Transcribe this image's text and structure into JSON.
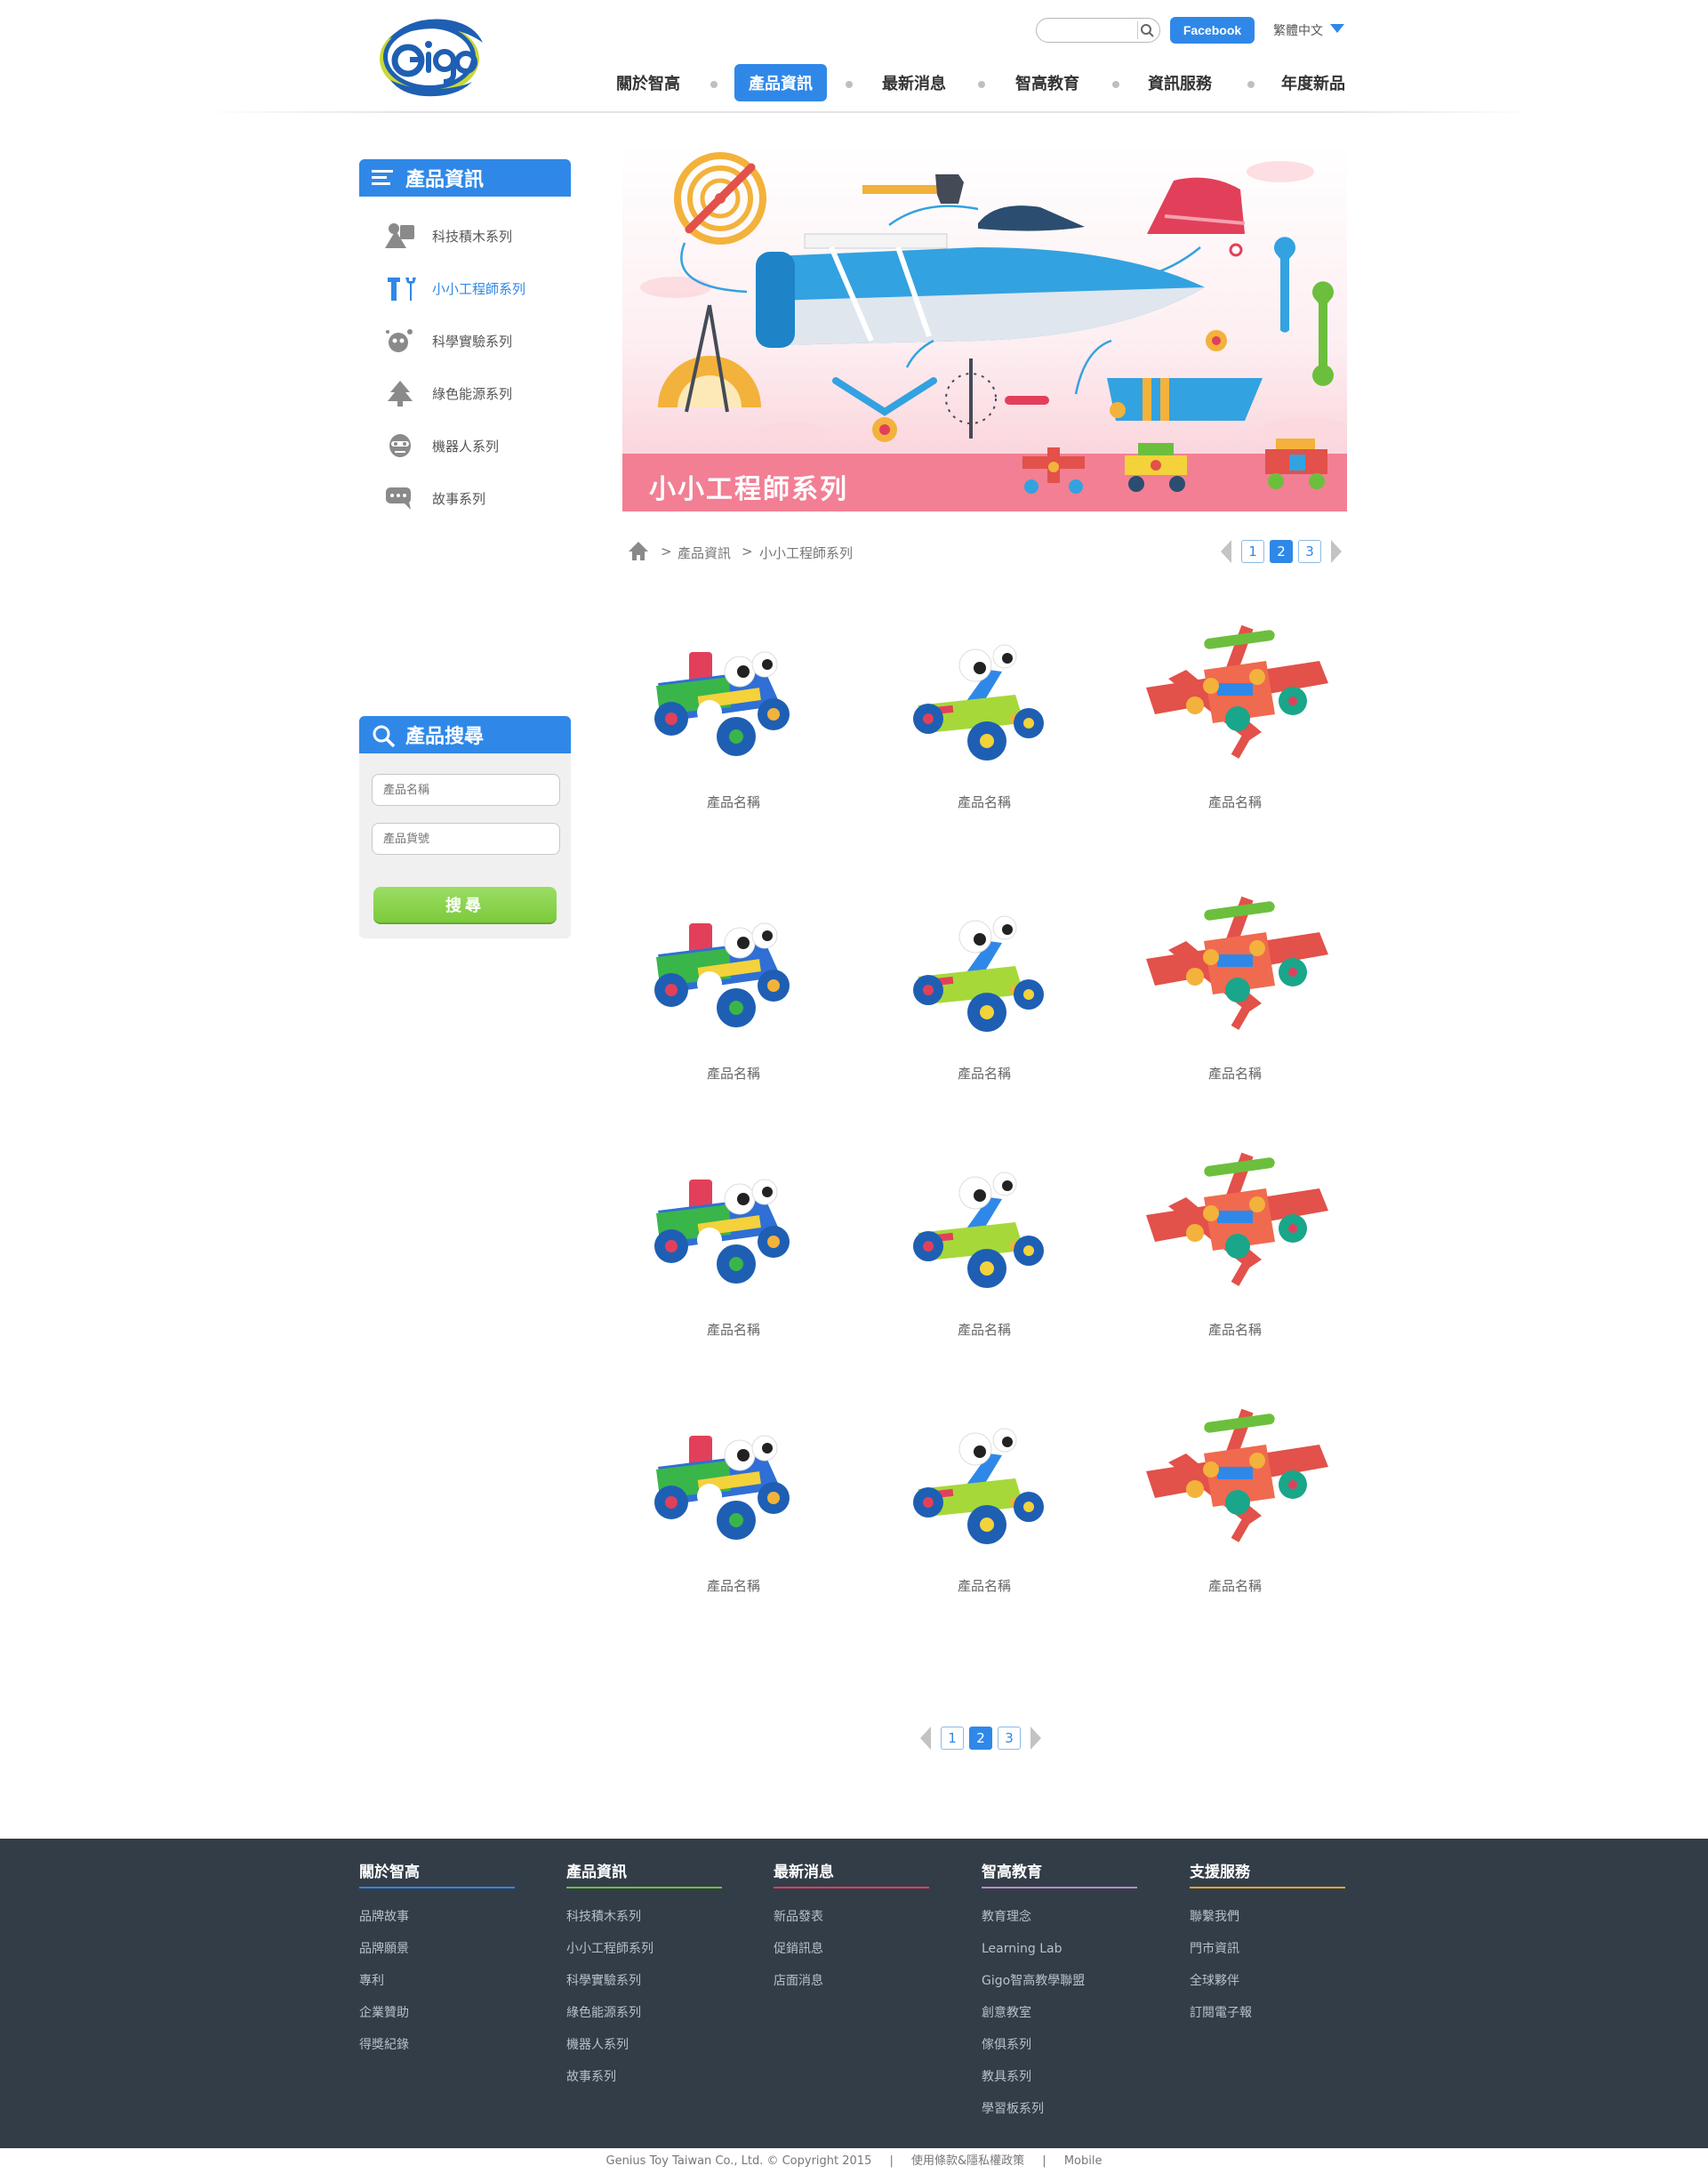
{
  "header": {
    "search_placeholder": "",
    "facebook_label": "Facebook",
    "language": "繁體中文",
    "nav": [
      {
        "label": "關於智高",
        "active": false
      },
      {
        "label": "產品資訊",
        "active": true
      },
      {
        "label": "最新消息",
        "active": false
      },
      {
        "label": "智高教育",
        "active": false
      },
      {
        "label": "資訊服務",
        "active": false
      },
      {
        "label": "年度新品",
        "active": false
      }
    ]
  },
  "sidebar": {
    "title": "產品資訊",
    "categories": [
      {
        "label": "科技積木系列",
        "icon": "shapes-icon"
      },
      {
        "label": "小小工程師系列",
        "icon": "tools-icon"
      },
      {
        "label": "科學實驗系列",
        "icon": "experiment-icon"
      },
      {
        "label": "綠色能源系列",
        "icon": "tree-icon"
      },
      {
        "label": "機器人系列",
        "icon": "robot-icon"
      },
      {
        "label": "故事系列",
        "icon": "chat-bubble-icon"
      }
    ],
    "active_category": "小小工程師系列"
  },
  "product_search": {
    "title": "產品搜尋",
    "name_placeholder": "產品名稱",
    "code_placeholder": "產品貨號",
    "submit_label": "搜尋"
  },
  "banner": {
    "title": "小小工程師系列"
  },
  "breadcrumb": {
    "separator": ">",
    "items": [
      "產品資訊",
      "小小工程師系列"
    ]
  },
  "pagination": {
    "pages": [
      "1",
      "2",
      "3"
    ],
    "current": "2"
  },
  "products": {
    "rows": [
      [
        "產品名稱",
        "產品名稱",
        "產品名稱"
      ],
      [
        "產品名稱",
        "產品名稱",
        "產品名稱"
      ],
      [
        "產品名稱",
        "產品名稱",
        "產品名稱"
      ],
      [
        "產品名稱",
        "產品名稱",
        "產品名稱"
      ]
    ],
    "types": [
      "racer-toy",
      "snail-car-toy",
      "airplane-toy"
    ]
  },
  "footer": {
    "columns": [
      {
        "title": "關於智高",
        "color": "#2f88e8",
        "links": [
          "品牌故事",
          "品牌願景",
          "專利",
          "企業贊助",
          "得獎紀錄"
        ]
      },
      {
        "title": "產品資訊",
        "color": "#6cbf3c",
        "links": [
          "科技積木系列",
          "小小工程師系列",
          "科學實驗系列",
          "綠色能源系列",
          "機器人系列",
          "故事系列"
        ]
      },
      {
        "title": "最新消息",
        "color": "#e2405a",
        "links": [
          "新品發表",
          "促銷訊息",
          "店面消息"
        ]
      },
      {
        "title": "智高教育",
        "color": "#b78ac7",
        "links": [
          "教育理念",
          "Learning Lab",
          "Gigo智高教學聯盟",
          "創意教室",
          "傢俱系列",
          "教具系列",
          "學習板系列"
        ]
      },
      {
        "title": "支援服務",
        "color": "#e8a62f",
        "links": [
          "聯繫我們",
          "門市資訊",
          "全球夥伴",
          "訂閱電子報"
        ]
      }
    ],
    "copyright": "Genius Toy Taiwan Co., Ltd. © Copyright 2015",
    "divider": "|",
    "policy": "使用條款&隱私權政策",
    "mobile": "Mobile"
  }
}
